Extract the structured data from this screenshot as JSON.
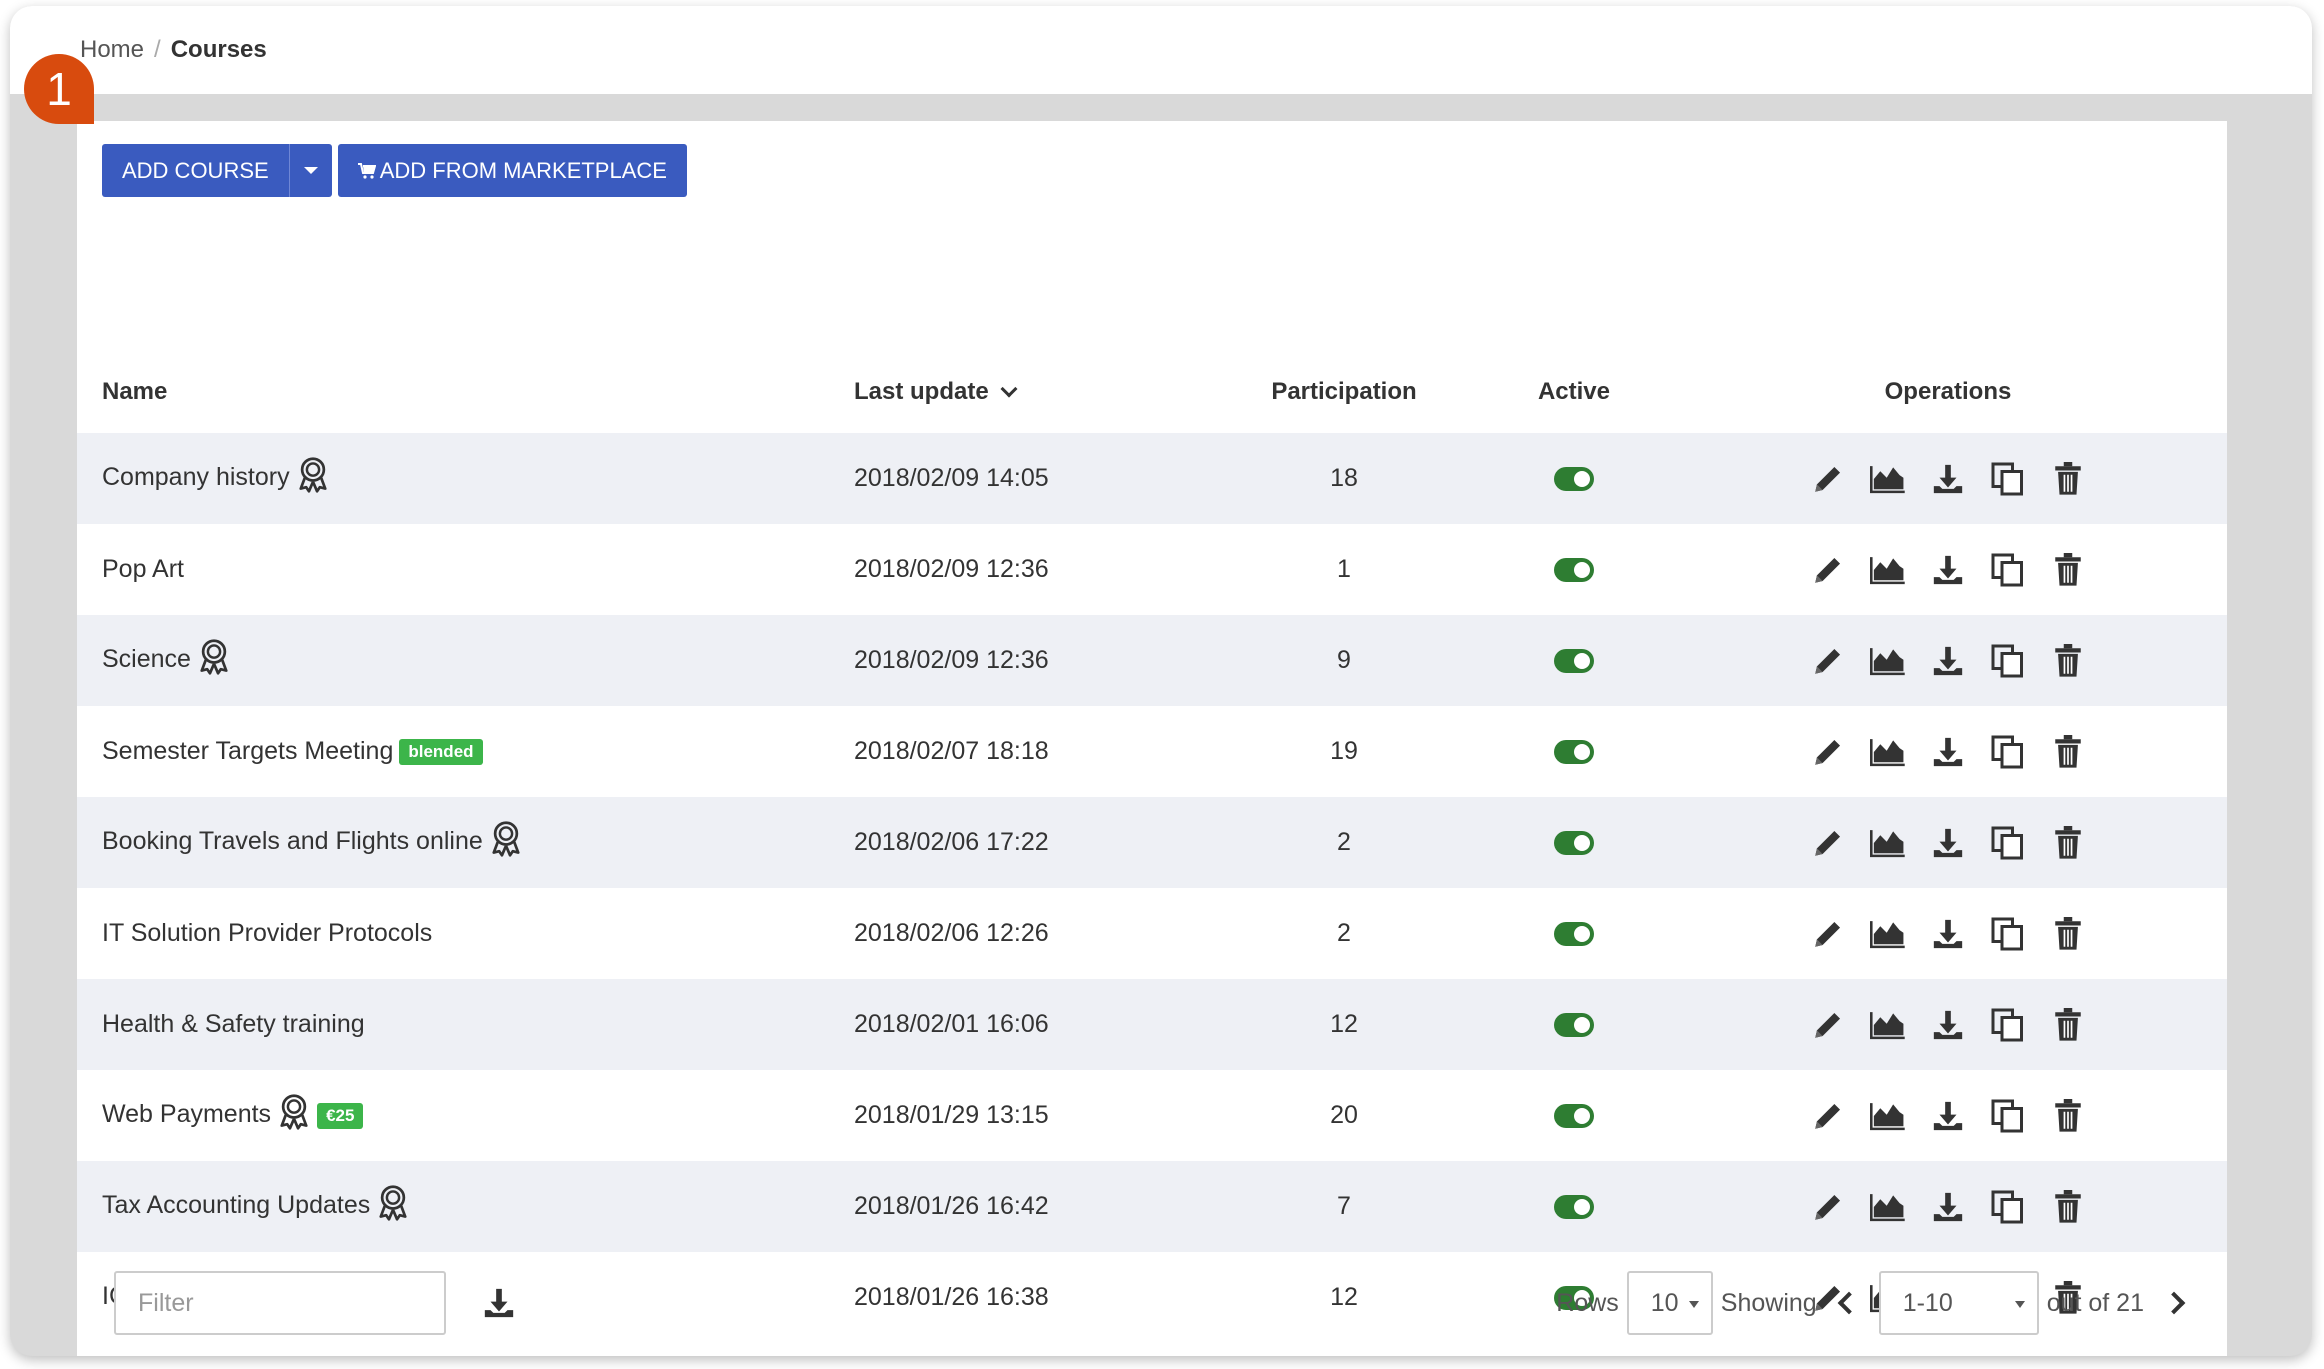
{
  "breadcrumb": {
    "home": "Home",
    "separator": "/",
    "current": "Courses"
  },
  "callout": {
    "number": "1",
    "color": "#d84b0e"
  },
  "toolbar": {
    "add_course_label": "ADD COURSE",
    "add_marketplace_label": "ADD FROM MARKETPLACE",
    "accent": "#3a5bbf"
  },
  "table": {
    "headers": {
      "name": "Name",
      "last_update": "Last update",
      "participation": "Participation",
      "active": "Active",
      "operations": "Operations"
    },
    "rows": [
      {
        "name": "Company history",
        "certificate": true,
        "tag": "",
        "last_update": "2018/02/09 14:05",
        "participation": "18",
        "active": true
      },
      {
        "name": "Pop Art",
        "certificate": false,
        "tag": "",
        "last_update": "2018/02/09 12:36",
        "participation": "1",
        "active": true
      },
      {
        "name": "Science",
        "certificate": true,
        "tag": "",
        "last_update": "2018/02/09 12:36",
        "participation": "9",
        "active": true
      },
      {
        "name": "Semester Targets Meeting",
        "certificate": false,
        "tag": "blended",
        "last_update": "2018/02/07 18:18",
        "participation": "19",
        "active": true
      },
      {
        "name": "Booking Travels and Flights online",
        "certificate": true,
        "tag": "",
        "last_update": "2018/02/06 17:22",
        "participation": "2",
        "active": true
      },
      {
        "name": "IT Solution Provider Protocols",
        "certificate": false,
        "tag": "",
        "last_update": "2018/02/06 12:26",
        "participation": "2",
        "active": true
      },
      {
        "name": "Health & Safety training",
        "certificate": false,
        "tag": "",
        "last_update": "2018/02/01 16:06",
        "participation": "12",
        "active": true
      },
      {
        "name": "Web Payments",
        "certificate": true,
        "tag": "€25",
        "last_update": "2018/01/29 13:15",
        "participation": "20",
        "active": true
      },
      {
        "name": "Tax Accounting Updates",
        "certificate": true,
        "tag": "",
        "last_update": "2018/01/26 16:42",
        "participation": "7",
        "active": true
      },
      {
        "name": "ICO explained",
        "certificate": true,
        "tag": "",
        "last_update": "2018/01/26 16:38",
        "participation": "12",
        "active": true
      }
    ],
    "operation_icons": [
      "pencil-icon",
      "area-chart-icon",
      "download-icon",
      "copy-icon",
      "trash-icon"
    ]
  },
  "footer": {
    "filter_placeholder": "Filter",
    "rows_label": "Rows",
    "rows_value": "10",
    "showing_label": "Showing",
    "range_value": "1-10",
    "out_of_label": "out of 21"
  },
  "colors": {
    "toggle_on": "#2e7d32",
    "tag_green": "#3cb54a",
    "row_alt": "#eef0f5"
  }
}
